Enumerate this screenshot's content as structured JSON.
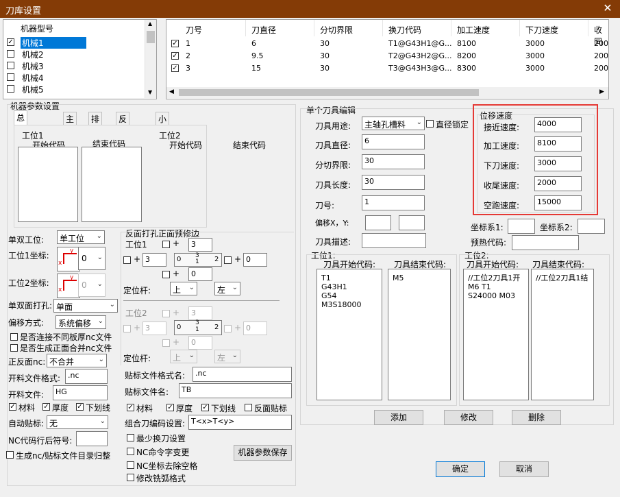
{
  "window": {
    "title": "刀库设置",
    "close": "✕"
  },
  "machine_list": {
    "header": "机器型号",
    "items": [
      {
        "label": "机械1",
        "checked": true
      },
      {
        "label": "机械2",
        "checked": false
      },
      {
        "label": "机械3",
        "checked": false
      },
      {
        "label": "机械4",
        "checked": false
      },
      {
        "label": "机械5",
        "checked": false
      }
    ]
  },
  "tool_table": {
    "columns": [
      "刀号",
      "刀直径",
      "分切界限",
      "换刀代码",
      "加工速度",
      "下刀速度",
      "收同"
    ],
    "rows": [
      {
        "checked": true,
        "cells": [
          "1",
          "6",
          "30",
          "T1@G43H1@G...",
          "8100",
          "3000",
          "200"
        ]
      },
      {
        "checked": true,
        "cells": [
          "2",
          "9.5",
          "30",
          "T2@G43H2@G...",
          "8200",
          "3000",
          "200"
        ]
      },
      {
        "checked": true,
        "cells": [
          "3",
          "15",
          "30",
          "T3@G43H3@G...",
          "8300",
          "3000",
          "200"
        ]
      }
    ]
  },
  "machine_params": {
    "group": "机器参数设置",
    "tabs": [
      "总文件头尾",
      "主轴",
      "排钻",
      "反面头尾",
      "小板头尾"
    ],
    "station1": "工位1",
    "station2": "工位2",
    "start_code": "开始代码",
    "end_code": "结束代码"
  },
  "left_form": {
    "single_double_label": "单双工位:",
    "single_double_value": "单工位",
    "s1_coord_label": "工位1坐标:",
    "s1_coord_value": "0",
    "s2_coord_label": "工位2坐标:",
    "s2_coord_value": "0",
    "drill_label": "单双面打孔:",
    "drill_value": "单面",
    "offset_label": "偏移方式:",
    "offset_value": "系统偏移",
    "connect_diff": "是否连接不同板厚nc文件",
    "gen_merge": "是否生成正面合并nc文件",
    "front_back_label": "正反面nc:",
    "front_back_value": "不合并",
    "open_fmt_label": "开料文件格式:",
    "open_fmt_value": ".nc",
    "open_file_label": "开料文件:",
    "open_file_value": "HG",
    "chk_material": "材料",
    "chk_thickness": "厚度",
    "chk_underline": "下划线",
    "auto_label_label": "自动贴标:",
    "auto_label_value": "无",
    "nc_suffix_label": "NC代码行后符号:",
    "gen_dir": "生成nc/贴标文件目录归整"
  },
  "back_drill": {
    "group": "反面打孔正面预修边",
    "s1": "工位1",
    "s2": "工位2",
    "plus": "+",
    "v_top": "3",
    "v_left": "3",
    "v_right": "0",
    "v_bottom": "0",
    "grid_0": "0",
    "grid_3": "3",
    "grid_1": "1",
    "grid_2": "2",
    "locator_label": "定位杆:",
    "loc_v1": "上",
    "loc_v2": "左"
  },
  "label_form": {
    "fmt_label": "贴标文件格式名:",
    "fmt_value": ".nc",
    "name_label": "贴标文件名:",
    "name_value": "TB",
    "chk_material": "材料",
    "chk_thickness": "厚度",
    "chk_underline": "下划线",
    "chk_back": "反面贴标",
    "combo_label": "组合刀编码设置:",
    "combo_value": "T<x>T<y>",
    "min_tool": "最少换刀设置",
    "nc_cmd": "NC命令字变更",
    "nc_space": "NC坐标去除空格",
    "mod_arc": "修改铣弧格式",
    "save_btn": "机器参数保存"
  },
  "tool_edit": {
    "group": "单个刀具编辑",
    "use_label": "刀具用途:",
    "use_value": "主轴孔槽料",
    "dia_lock": "直径锁定",
    "dia_label": "刀具直径:",
    "dia_value": "6",
    "cut_label": "分切界限:",
    "cut_value": "30",
    "len_label": "刀具长度:",
    "len_value": "30",
    "num_label": "刀号:",
    "num_value": "1",
    "offset_label": "偏移X，Y:",
    "desc_label": "刀具描述:",
    "speed_group": "位移速度",
    "approach_label": "接近速度:",
    "approach_value": "4000",
    "work_label": "加工速度:",
    "work_value": "8100",
    "down_label": "下刀速度:",
    "down_value": "3000",
    "tail_label": "收尾速度:",
    "tail_value": "2000",
    "idle_label": "空跑速度:",
    "idle_value": "15000",
    "coord1_label": "坐标系1:",
    "coord2_label": "坐标系2:",
    "preheat_label": "预热代码:",
    "st1": "工位1:",
    "st2": "工位2:",
    "st1_start_label": "刀具开始代码:",
    "st1_end_label": "刀具结束代码:",
    "st2_start_label": "刀具开始代码:",
    "st2_end_label": "刀具结束代码:",
    "st1_start": "T1\nG43H1\nG54\nM3S18000",
    "st1_end": "M5",
    "st2_start": "//工位2刀具1开\nM6 T1\nS24000 M03",
    "st2_end": "//工位2刀具1结",
    "add": "添加",
    "modify": "修改",
    "delete": "删除"
  },
  "footer": {
    "ok": "确定",
    "cancel": "取消"
  },
  "colors": {
    "title_bar": "#843b06",
    "highlight": "#e53935",
    "selection": "#0078d7"
  }
}
